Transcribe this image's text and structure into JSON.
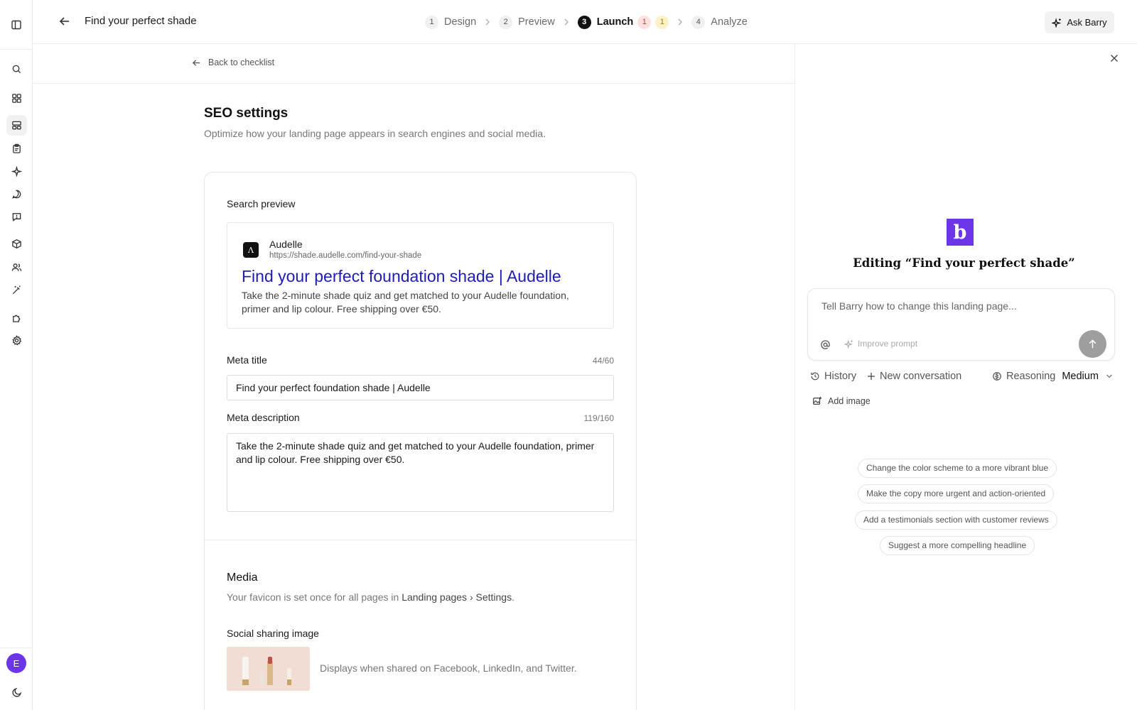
{
  "header": {
    "page_title": "Find your perfect shade",
    "steps": [
      {
        "num": "1",
        "label": "Design"
      },
      {
        "num": "2",
        "label": "Preview"
      },
      {
        "num": "3",
        "label": "Launch"
      },
      {
        "num": "4",
        "label": "Analyze"
      }
    ],
    "launch_badges": {
      "errors": "1",
      "warnings": "1"
    },
    "ask_label": "Ask Barry"
  },
  "sidebar": {
    "avatar_initial": "E",
    "icons": [
      "panel-toggle-icon",
      "search-icon",
      "apps-icon",
      "layout-icon",
      "clipboard-icon",
      "sparkle-icon",
      "chat-icon",
      "feedback-icon",
      "box-icon",
      "users-icon",
      "magic-wand-icon",
      "integrations-icon",
      "settings-icon",
      "moon-icon"
    ]
  },
  "main": {
    "back_label": "Back to checklist",
    "title": "SEO settings",
    "subtitle": "Optimize how your landing page appears in search engines and social media.",
    "search_preview": {
      "label": "Search preview",
      "logo_letter": "Λ",
      "site_name": "Audelle",
      "url": "https://shade.audelle.com/find-your-shade",
      "result_title": "Find your perfect foundation shade | Audelle",
      "result_description": "Take the 2-minute shade quiz and get matched to your Audelle foundation, primer and lip colour. Free shipping over €50."
    },
    "meta_title": {
      "label": "Meta title",
      "counter": "44/60",
      "value": "Find your perfect foundation shade | Audelle"
    },
    "meta_description": {
      "label": "Meta description",
      "counter": "119/160",
      "value": "Take the 2-minute shade quiz and get matched to your Audelle foundation, primer and lip colour. Free shipping over €50."
    },
    "media": {
      "title": "Media",
      "subtitle_prefix": "Your favicon is set once for all pages in ",
      "subtitle_link": "Landing pages › Settings",
      "subtitle_suffix": ".",
      "social_label": "Social sharing image",
      "social_description": "Displays when shared on Facebook, LinkedIn, and Twitter."
    }
  },
  "panel": {
    "logo_letter": "b",
    "heading": "Editing “Find your perfect shade”",
    "composer_placeholder": "Tell Barry how to change this landing page...",
    "improve_label": "Improve prompt",
    "history_label": "History",
    "new_conversation_label": "New conversation",
    "reasoning_label": "Reasoning",
    "reasoning_value": "Medium",
    "add_image_label": "Add image",
    "suggestions": [
      "Change the color scheme to a more vibrant blue",
      "Make the copy more urgent and action-oriented",
      "Add a testimonials section with customer reviews",
      "Suggest a more compelling headline"
    ]
  },
  "colors": {
    "accent": "#6d35e8",
    "link_blue": "#1f1cb5",
    "error_badge": "#fde1e1",
    "warning_badge": "#fdf1c8"
  }
}
